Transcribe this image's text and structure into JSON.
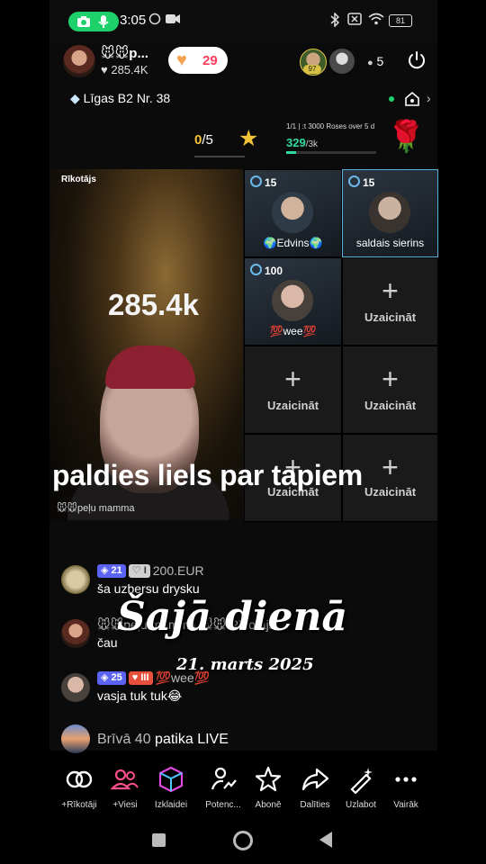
{
  "status": {
    "time": "3:05",
    "battery": "81"
  },
  "host": {
    "name": "🐭🐭p...",
    "likes": "285.4K",
    "follow_count": "29"
  },
  "top_viewers": {
    "v1_level": "97",
    "count": "5"
  },
  "league": {
    "label": "Līgas B2 Nr. 38"
  },
  "score": {
    "value": "0",
    "total": "/5",
    "progress": 0
  },
  "goal": {
    "text": "1/1 | :t 3000 Roses over 5 d",
    "current": "329",
    "target": "/3k",
    "progress": 0.11
  },
  "stage": {
    "host_label": "Rīkotājs",
    "host_count": "285.4k",
    "host_tag": "🐭🐭peļu mamma",
    "caption": "paldies liels par tapiem",
    "guests": [
      {
        "coins": "15",
        "name": "🌍Edvins🌍"
      },
      {
        "coins": "15",
        "name": "saldais sierins"
      },
      {
        "coins": "100",
        "name": "💯wee💯"
      }
    ],
    "invite_label": "Uzaicināt",
    "plus": "+"
  },
  "chat": [
    {
      "level": "21",
      "badge2": "I",
      "name": "200.EUR",
      "message": "ša uzbersu drysku"
    },
    {
      "name": "🐭🐭peļu mamma 🐭🐭 Rīkotājs",
      "message": "čau"
    },
    {
      "level": "25",
      "badge2": "III",
      "name": "💯wee💯",
      "message": "vasja tuk tuk😂"
    },
    {
      "name": "Brīvā 40",
      "message": "patika LIVE"
    }
  ],
  "overlay": {
    "title": "Šajā dienā",
    "date": "21. marts 2025"
  },
  "toolbar": [
    {
      "icon": "link-icon",
      "label": "+Rīkotāji"
    },
    {
      "icon": "users-icon",
      "label": "+Viesi"
    },
    {
      "icon": "cube-icon",
      "label": "Izklaidei"
    },
    {
      "icon": "potential-icon",
      "label": "Potenc..."
    },
    {
      "icon": "star-icon",
      "label": "Abonē"
    },
    {
      "icon": "share-icon",
      "label": "Dalīties"
    },
    {
      "icon": "magic-wand-icon",
      "label": "Uzlabot"
    },
    {
      "icon": "more-icon",
      "label": "Vairāk"
    }
  ],
  "colors": {
    "accent_green": "#1fd16a",
    "goal_green": "#2fdca0",
    "gold": "#f2c337",
    "pink": "#ff3b5c"
  }
}
